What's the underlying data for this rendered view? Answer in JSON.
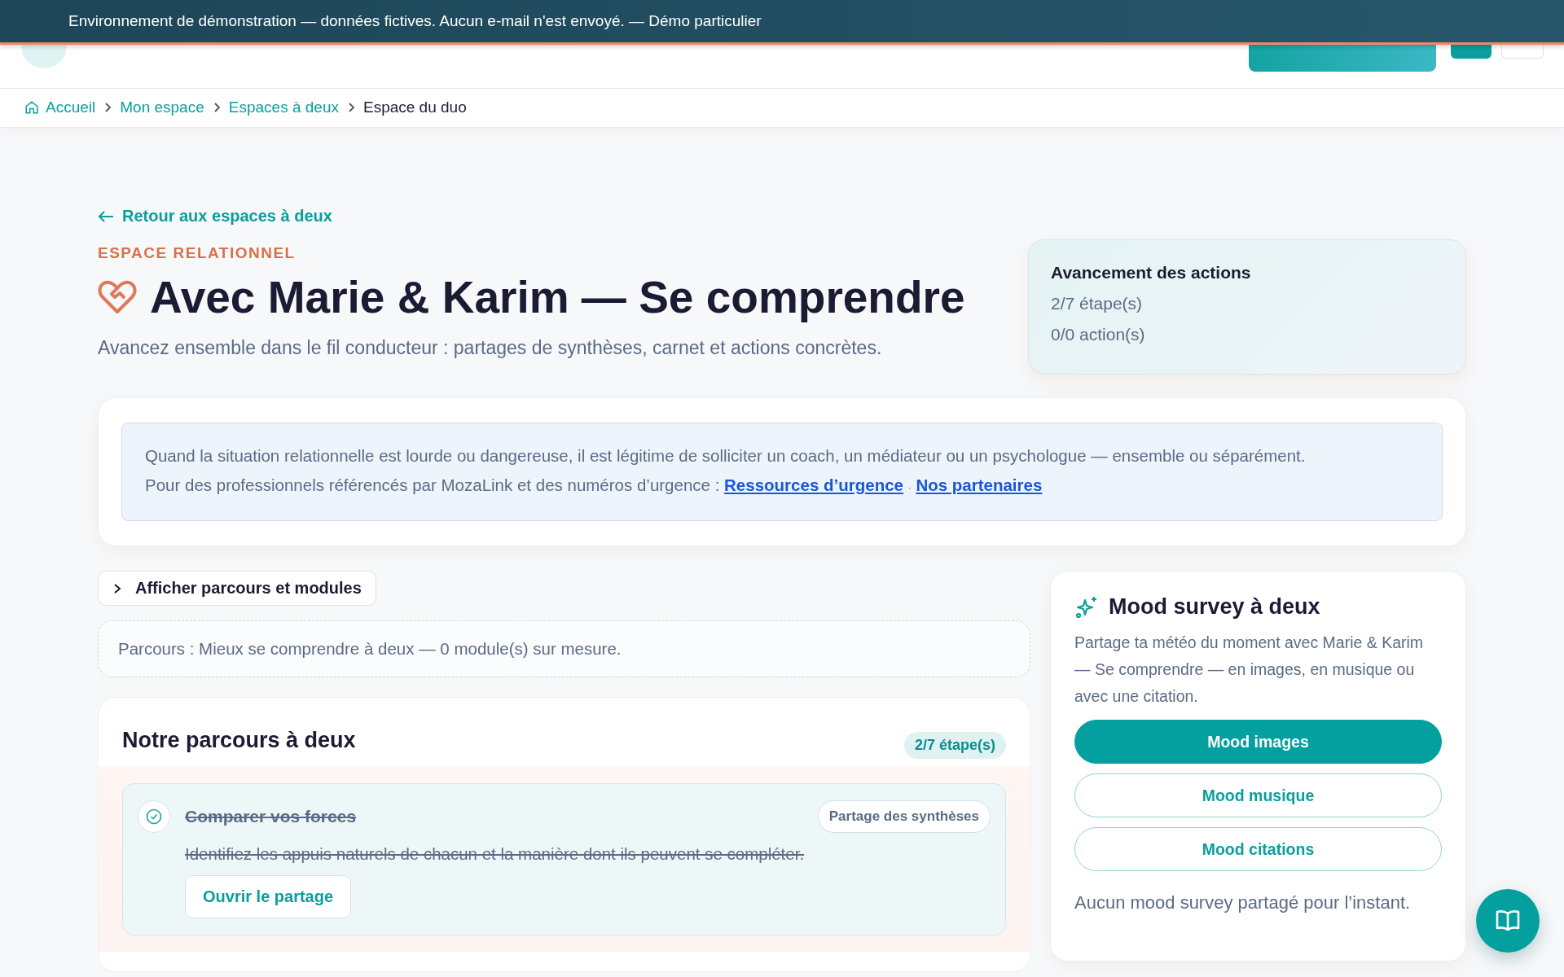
{
  "banner": {
    "text": "Environnement de démonstration — données fictives. Aucun e-mail n'est envoyé. — Démo particulier"
  },
  "breadcrumb": [
    {
      "label": "Accueil",
      "current": false,
      "kind": "home"
    },
    {
      "label": "Mon espace",
      "current": false,
      "kind": "link"
    },
    {
      "label": "Espaces à deux",
      "current": false,
      "kind": "link"
    },
    {
      "label": "Espace du duo",
      "current": true,
      "kind": "link"
    }
  ],
  "back_link": "Retour aux espaces à deux",
  "eyebrow": "ESPACE RELATIONNEL",
  "title": "Avec Marie & Karim — Se comprendre",
  "subtitle": "Avancez ensemble dans le fil conducteur : partages de synthèses, carnet et actions concrètes.",
  "progress": {
    "title": "Avancement des actions",
    "lines": [
      "2/7 étape(s)",
      "0/0 action(s)"
    ]
  },
  "notice": {
    "line_1": "Quand la situation relationnelle est lourde ou dangereuse, il est légitime de solliciter un coach, un médiateur ou un psychologue — ensemble ou séparément.",
    "line_2": "Pour des professionnels référencés par MozaLink et des numéros d’urgence :",
    "links": [
      "Ressources d’urgence",
      "Nos partenaires"
    ],
    "separator": "·"
  },
  "toggle": {
    "label": "Afficher parcours et modules",
    "expanded": false
  },
  "parcours_summary": "Parcours : Mieux se comprendre à deux — 0 module(s) sur mesure.",
  "journey": {
    "title": "Notre parcours à deux",
    "badge": "2/7 étape(s)",
    "steps": [
      {
        "title": "Comparer vos forces",
        "description": "Identifiez les appuis naturels de chacun et la manière dont ils peuvent se compléter.",
        "done": true,
        "tag": "Partage des synthèses",
        "button": "Ouvrir le partage"
      }
    ]
  },
  "mood": {
    "title": "Mood survey à deux",
    "description": "Partage ta météo du moment avec Marie & Karim — Se comprendre — en images, en musique ou avec une citation.",
    "buttons": [
      {
        "label": "Mood images",
        "selected": true
      },
      {
        "label": "Mood musique",
        "selected": false
      },
      {
        "label": "Mood citations",
        "selected": false
      }
    ],
    "empty": "Aucun mood survey partagé pour l’instant."
  }
}
